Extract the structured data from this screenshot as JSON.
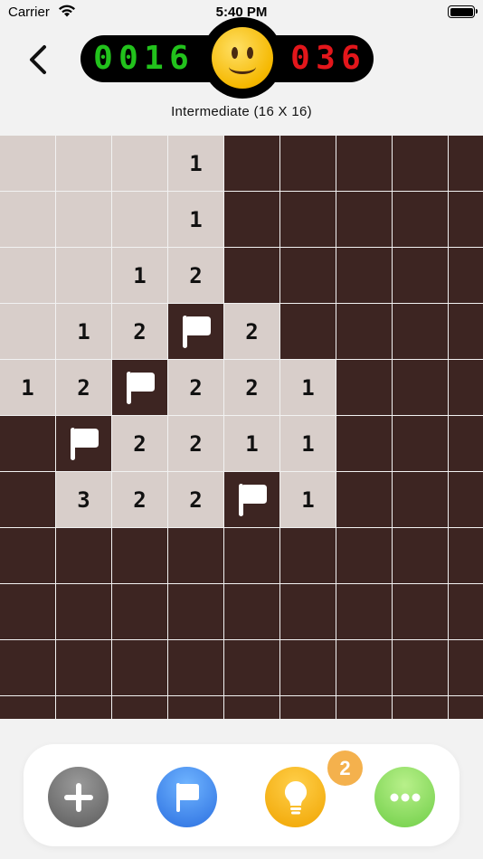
{
  "status_bar": {
    "carrier": "Carrier",
    "time": "5:40 PM"
  },
  "header": {
    "elapsed_digits": [
      "0",
      "0",
      "1",
      "6"
    ],
    "mines_remaining_digits": [
      "0",
      "3",
      "6"
    ],
    "mode_label": "Intermediate (16 X 16)"
  },
  "board": {
    "cols_visible": 9,
    "rows_visible": 11,
    "rows": [
      [
        "o",
        "o",
        "o",
        "1",
        "h",
        "h",
        "h",
        "h",
        "h"
      ],
      [
        "o",
        "o",
        "o",
        "1",
        "h",
        "h",
        "h",
        "h",
        "h"
      ],
      [
        "o",
        "o",
        "1",
        "2",
        "h",
        "h",
        "h",
        "h",
        "h"
      ],
      [
        "o",
        "1",
        "2",
        "F",
        "2",
        "h",
        "h",
        "h",
        "h"
      ],
      [
        "1",
        "2",
        "F",
        "2",
        "2",
        "1",
        "h",
        "h",
        "h"
      ],
      [
        "h",
        "F",
        "2",
        "2",
        "1",
        "1",
        "h",
        "h",
        "h"
      ],
      [
        "h",
        "3",
        "2",
        "2",
        "F",
        "1",
        "h",
        "h",
        "h"
      ],
      [
        "h",
        "h",
        "h",
        "h",
        "h",
        "h",
        "h",
        "h",
        "h"
      ],
      [
        "h",
        "h",
        "h",
        "h",
        "h",
        "h",
        "h",
        "h",
        "h"
      ],
      [
        "h",
        "h",
        "h",
        "h",
        "h",
        "h",
        "h",
        "h",
        "h"
      ],
      [
        "h",
        "h",
        "h",
        "h",
        "h",
        "h",
        "h",
        "h",
        "h"
      ]
    ],
    "colors": {
      "hidden": "#3d2522",
      "open": "#d8ceca",
      "grid": "#f2f2f2"
    }
  },
  "toolbar": {
    "hint_count": "2",
    "buttons": [
      {
        "name": "new-game-button",
        "icon": "plus-icon"
      },
      {
        "name": "flag-mode-button",
        "icon": "flag-icon"
      },
      {
        "name": "hint-button",
        "icon": "lightbulb-icon"
      },
      {
        "name": "more-options-button",
        "icon": "ellipsis-icon"
      }
    ]
  }
}
